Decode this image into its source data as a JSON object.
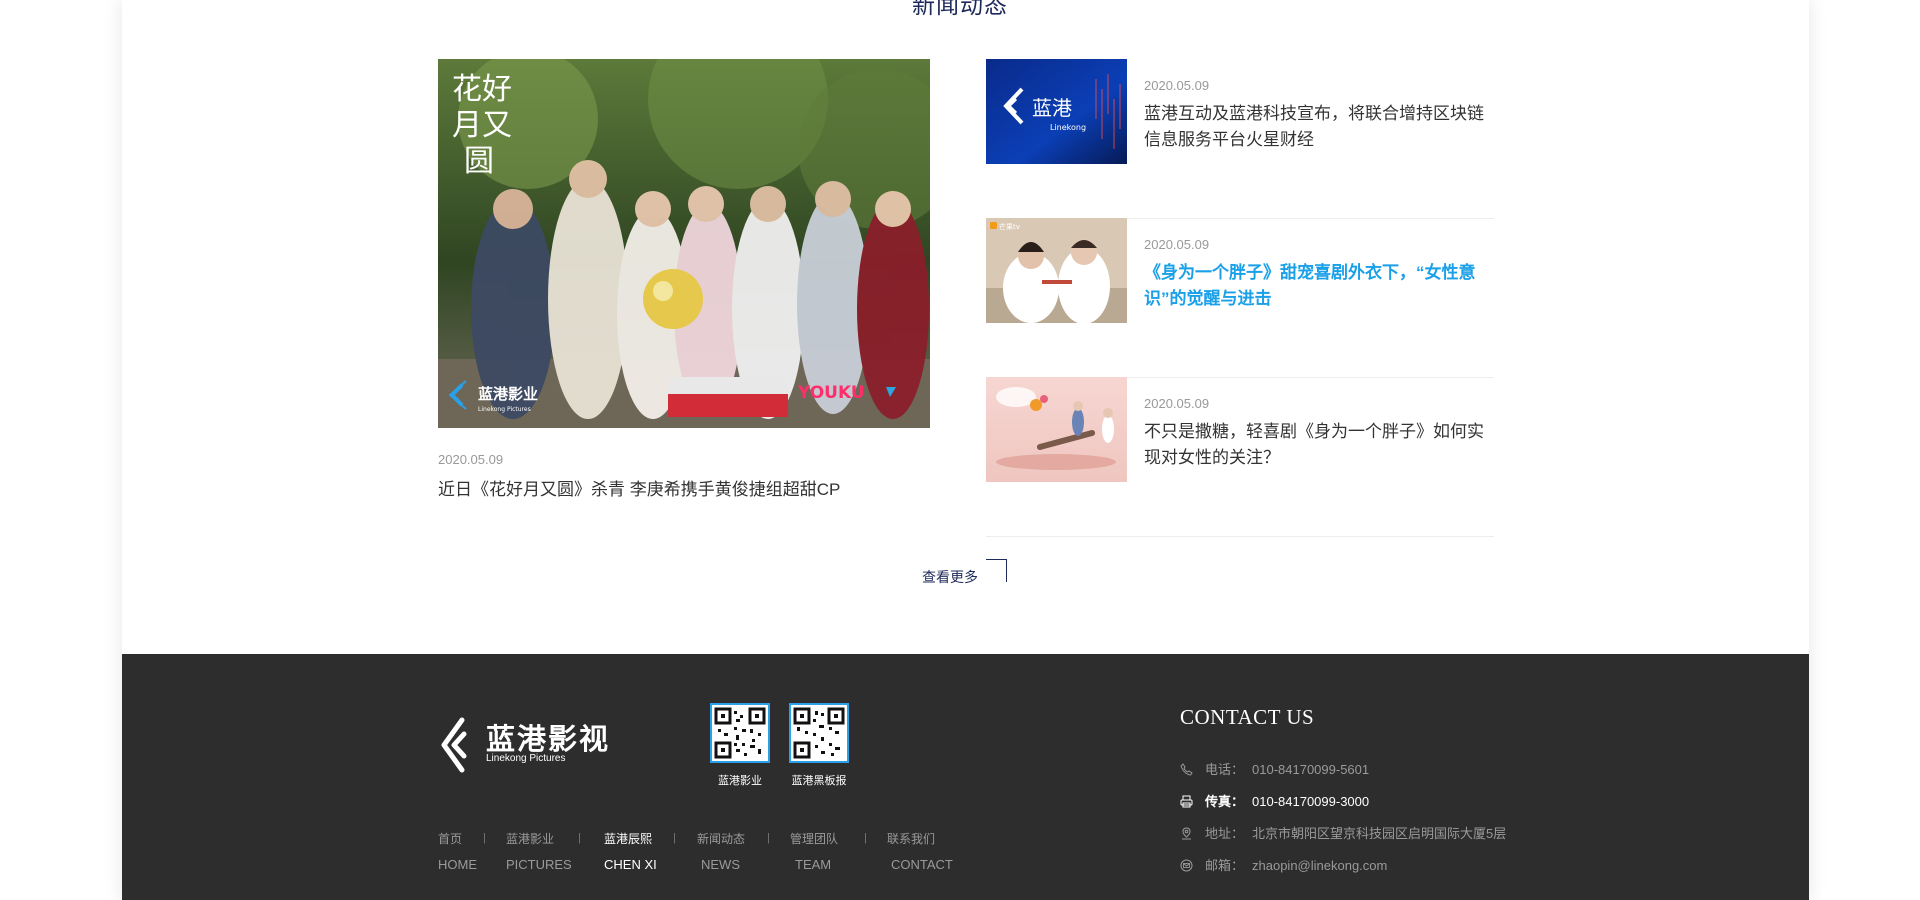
{
  "section": {
    "title": "新闻动态"
  },
  "featured": {
    "date": "2020.05.09",
    "title": "近日《花好月又圆》杀青 李庚希携手黄俊捷组超甜CP",
    "image_calligraphy": [
      "花好",
      "月又",
      "圆"
    ],
    "image_logo_cn": "蓝港影业",
    "image_logo_en": "Linekong Pictures",
    "image_watermark": "YOUKU"
  },
  "news": [
    {
      "date": "2020.05.09",
      "title": "蓝港互动及蓝港科技宣布，将联合增持区块链信息服务平台火星财经",
      "thumb_logo_cn": "蓝港",
      "thumb_logo_en": "Linekong",
      "active": false
    },
    {
      "date": "2020.05.09",
      "title": "《身为一个胖子》甜宠喜剧外衣下，“女性意识”的觉醒与进击",
      "thumb_badge": "芒果tv",
      "active": true
    },
    {
      "date": "2020.05.09",
      "title": "不只是撒糖，轻喜剧《身为一个胖子》如何实现对女性的关注？",
      "active": false
    }
  ],
  "view_more": "查看更多",
  "footer": {
    "logo_cn": "蓝港影视",
    "logo_en": "Linekong Pictures",
    "qr": [
      {
        "label": "蓝港影业"
      },
      {
        "label": "蓝港黑板报"
      }
    ],
    "nav": [
      {
        "cn": "首页",
        "en": "HOME",
        "active": false
      },
      {
        "cn": "蓝港影业",
        "en": "PICTURES",
        "active": false
      },
      {
        "cn": "蓝港辰熙",
        "en": "CHEN XI",
        "active": true
      },
      {
        "cn": "新闻动态",
        "en": "NEWS",
        "active": false
      },
      {
        "cn": "管理团队",
        "en": "TEAM",
        "active": false
      },
      {
        "cn": "联系我们",
        "en": "CONTACT",
        "active": false
      }
    ],
    "nav_separator": "|",
    "contact_title": "CONTACT US",
    "contact": [
      {
        "icon": "phone-icon",
        "label": "电话：",
        "value": "010-84170099-5601"
      },
      {
        "icon": "fax-icon",
        "label": "传真：",
        "value": "010-84170099-3000"
      },
      {
        "icon": "location-icon",
        "label": "地址：",
        "value": "北京市朝阳区望京科技园区启明国际大厦5层"
      },
      {
        "icon": "mail-icon",
        "label": "邮箱：",
        "value": "zhaopin@linekong.com"
      }
    ]
  },
  "colors": {
    "accent": "#1aa0e8",
    "footer_bg": "#2d2d2d",
    "title": "#1e2a5a"
  }
}
